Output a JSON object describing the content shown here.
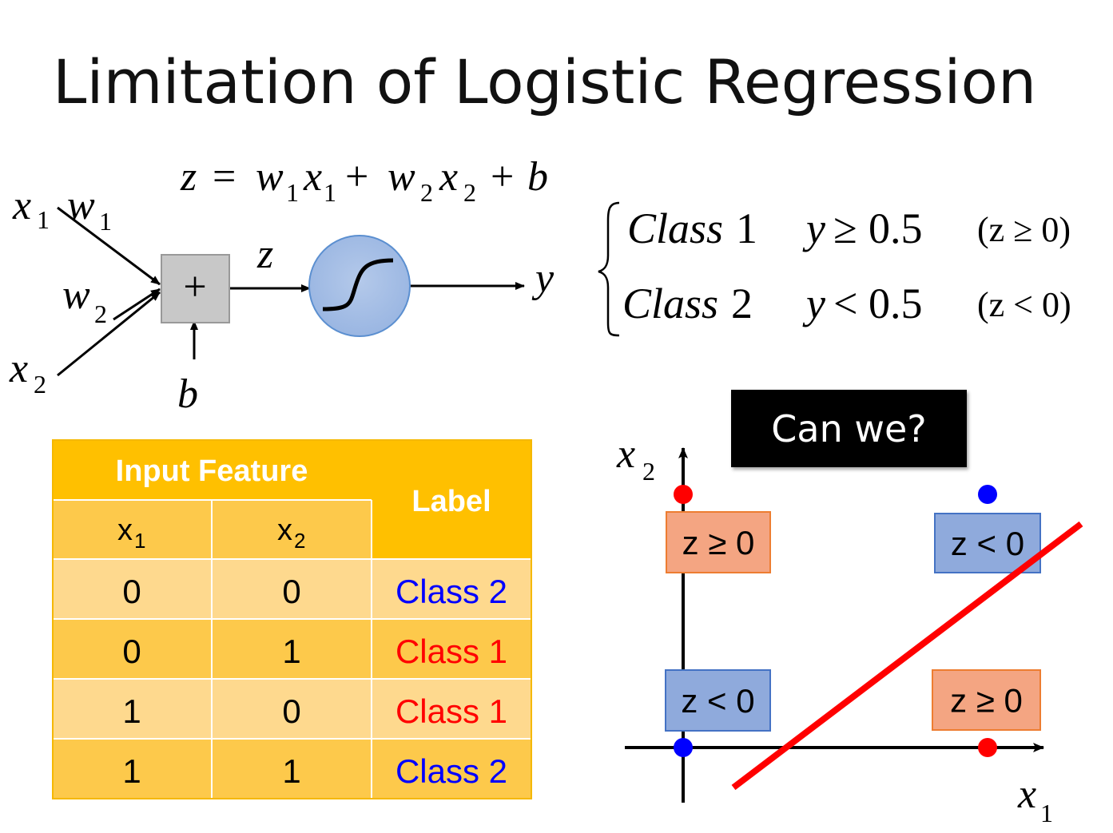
{
  "title": "Limitation of Logistic Regression",
  "diagram": {
    "eq": {
      "z": "z",
      "eq": "=",
      "w": "w",
      "x": "x",
      "s1": "1",
      "s2": "2",
      "plus": "+",
      "b": "b"
    },
    "labels": {
      "x": "x",
      "w": "w",
      "one": "1",
      "two": "2",
      "z": "z",
      "b": "b",
      "y": "y",
      "sum": "+"
    }
  },
  "decision_rule": {
    "rows": [
      {
        "cls": "Class",
        "num": "1",
        "y": "y",
        "op": "≥",
        "val": "0.5",
        "zcond": "(z ≥ 0)"
      },
      {
        "cls": "Class",
        "num": "2",
        "y": "y",
        "op": "<",
        "val": "0.5",
        "zcond": "(z < 0)"
      }
    ]
  },
  "table": {
    "header_input": "Input Feature",
    "header_label": "Label",
    "sub_x": "x",
    "sub_1": "1",
    "sub_2": "2",
    "rows": [
      {
        "x1": "0",
        "x2": "0",
        "label": "Class 2",
        "color": "#0000ff"
      },
      {
        "x1": "0",
        "x2": "1",
        "label": "Class 1",
        "color": "#ff0000"
      },
      {
        "x1": "1",
        "x2": "0",
        "label": "Class 1",
        "color": "#ff0000"
      },
      {
        "x1": "1",
        "x2": "1",
        "label": "Class 2",
        "color": "#0000ff"
      }
    ],
    "colors": {
      "header": "#ffc000",
      "row_light": "#fed98e",
      "row_dark": "#fdc94b",
      "border": "#ffffff"
    }
  },
  "can_we": "Can we?",
  "plot": {
    "x_label": "x",
    "x_sub": "1",
    "y_label": "x",
    "y_sub": "2",
    "boxes": [
      {
        "text": "z ≥ 0",
        "kind": "pos"
      },
      {
        "text": "z < 0",
        "kind": "neg"
      },
      {
        "text": "z < 0",
        "kind": "neg"
      },
      {
        "text": "z ≥ 0",
        "kind": "pos"
      }
    ],
    "colors": {
      "pos_fill": "#f4a582",
      "pos_stroke": "#ed7d31",
      "neg_fill": "#8faadc",
      "neg_stroke": "#4472c4",
      "class1": "#ff0000",
      "class2": "#0000ff",
      "line": "#ff0000"
    }
  }
}
